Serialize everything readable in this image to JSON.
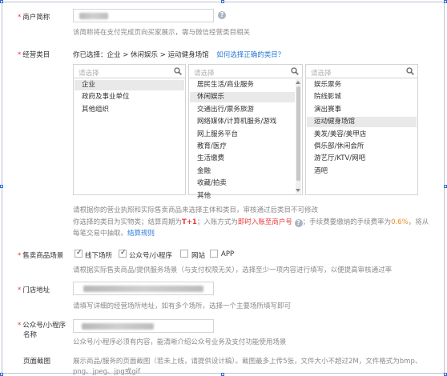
{
  "merchant_name": {
    "label": "商户简称",
    "hint": "该简称将在支付完成页向买家展示，需与微信经营类目相关"
  },
  "category": {
    "label": "经营类目",
    "selected_prefix": "你已选择：",
    "selected_path": "企业 > 休闲娱乐 > 运动健身场馆",
    "help_link": "如何选择正确的类目？",
    "search_placeholder": "请选择",
    "col1": [
      "企业",
      "政府及事业单位",
      "其他组织"
    ],
    "col1_selected": 0,
    "col2": [
      "居民生活/商业服务",
      "休闲娱乐",
      "交通出行/票务旅游",
      "网络媒体/计算机服务/游戏",
      "网上服务平台",
      "教育/医疗",
      "生活缴费",
      "金融",
      "收藏/拍卖",
      "其他"
    ],
    "col2_selected": 1,
    "col3": [
      "娱乐票务",
      "院线影城",
      "演出赛事",
      "运动健身场馆",
      "美发/美容/美甲店",
      "俱乐部/休闲会所",
      "游艺厅/KTV/网吧",
      "酒吧"
    ],
    "col3_selected": 3,
    "note1": "请根据你的营业执照和实际售卖商品来选择主体和类目，审核通过后类目不可修改",
    "note2_a": "你选择的类目为实物类；结算周期为",
    "note2_t1": "T+1",
    "note2_b": "；入账方式为",
    "note2_account": "即时入账至商户号",
    "note2_c": "；手续费要缴纳的手续费率为",
    "note2_rate": "0.6%",
    "note2_d": "，将从",
    "note3_a": "每笔交易中抽取。",
    "note3_link": "结算规则"
  },
  "scene": {
    "label": "售卖商品场景",
    "options": [
      {
        "label": "线下场所",
        "checked": true
      },
      {
        "label": "公众号/小程序",
        "checked": true
      },
      {
        "label": "网站",
        "checked": false
      },
      {
        "label": "APP",
        "checked": false
      }
    ],
    "hint": "请根据实际售卖商品/提供服务场景（与支付权限无关），选择至少一项内容进行填写，以便提高审核通过率"
  },
  "store_address": {
    "label": "门店地址",
    "hint": "请填写详细的经营场所地址，如有多个场所，选择一个主要场所填写即可"
  },
  "mp_name": {
    "label_1": "公众号/小程序",
    "label_2": "名称",
    "hint": "公众号/小程序必须有内容，能清晰介绍公众号业务及支付功能使用场景"
  },
  "page_screenshot": {
    "label": "页面截图",
    "hint_1": "展示商品/服务的页面截图（若未上线，请提供设计稿）。截图最多上传5张，文件大小不超过2M，文件格式为bmp、",
    "hint_2": "png、jpeg、jpg或gif"
  },
  "colors": {
    "required": "#e6393b",
    "link": "#2b7cd6",
    "rate": "#f08a24"
  }
}
